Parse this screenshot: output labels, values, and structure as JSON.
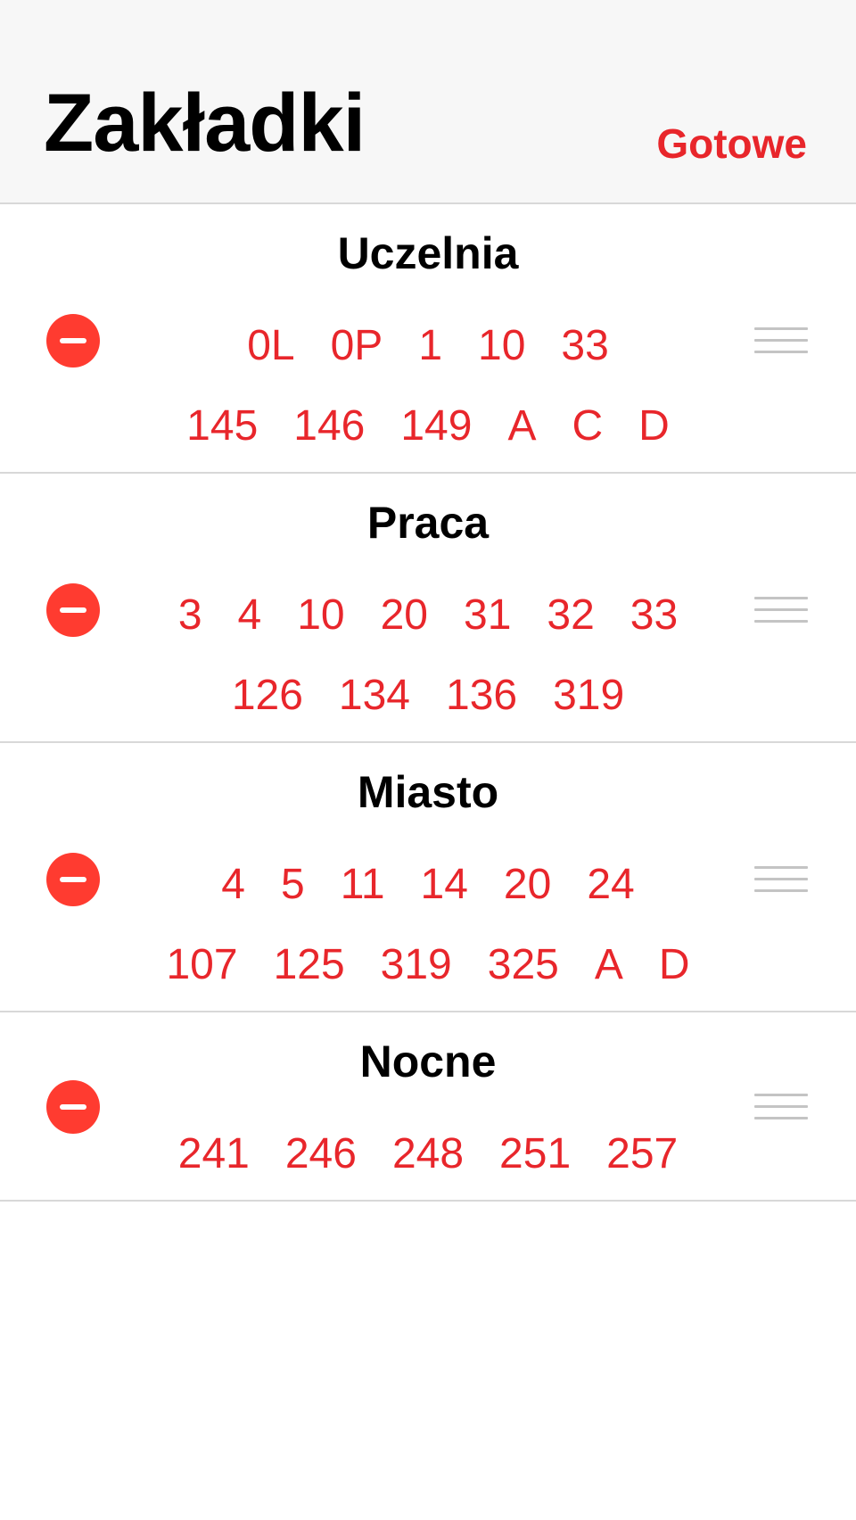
{
  "header": {
    "title": "Zakładki",
    "done_label": "Gotowe"
  },
  "colors": {
    "accent": "#e8262b",
    "delete": "#ff3b30",
    "handle": "#c4c4c4",
    "header_bg": "#f7f7f7"
  },
  "icons": {
    "delete": "minus-circle-icon",
    "reorder": "reorder-handle-icon"
  },
  "groups": [
    {
      "name": "Uczelnia",
      "rows": [
        [
          "0L",
          "0P",
          "1",
          "10",
          "33"
        ],
        [
          "145",
          "146",
          "149",
          "A",
          "C",
          "D"
        ]
      ]
    },
    {
      "name": "Praca",
      "rows": [
        [
          "3",
          "4",
          "10",
          "20",
          "31",
          "32",
          "33"
        ],
        [
          "126",
          "134",
          "136",
          "319"
        ]
      ]
    },
    {
      "name": "Miasto",
      "rows": [
        [
          "4",
          "5",
          "11",
          "14",
          "20",
          "24"
        ],
        [
          "107",
          "125",
          "319",
          "325",
          "A",
          "D"
        ]
      ]
    },
    {
      "name": "Nocne",
      "rows": [
        [
          "241",
          "246",
          "248",
          "251",
          "257"
        ]
      ]
    }
  ]
}
